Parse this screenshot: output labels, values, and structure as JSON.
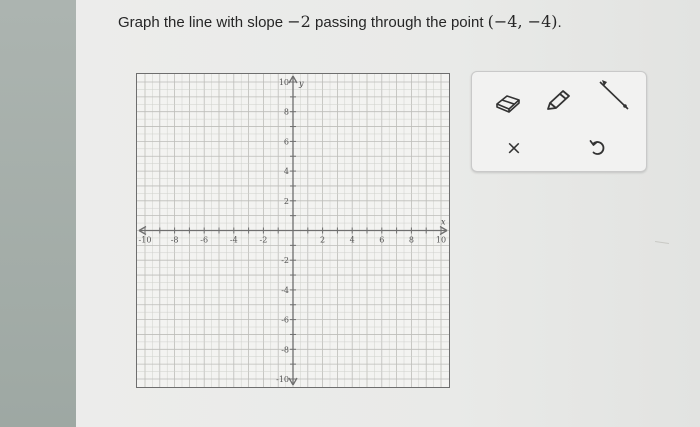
{
  "question": {
    "prefix": "Graph the line with slope ",
    "slope": "−2",
    "middle": " passing through the point ",
    "point": "(−4, −4)",
    "suffix": "."
  },
  "graph": {
    "x_range": [
      -10,
      10
    ],
    "y_range": [
      -10,
      10
    ],
    "grid_step": 0.5,
    "labeled_step": 2,
    "x_axis_label": "x",
    "y_axis_label": "y",
    "x_tick_labels": [
      "-10",
      "-8",
      "-6",
      "-4",
      "-2",
      "2",
      "4",
      "6",
      "8",
      "10"
    ],
    "y_tick_labels": [
      "10",
      "8",
      "6",
      "4",
      "2",
      "-2",
      "-4",
      "-6",
      "-8",
      "-10"
    ]
  },
  "toolbar": {
    "eraser": "eraser-icon",
    "pencil": "pencil-icon",
    "line": "line-tool-icon",
    "clear": "×",
    "undo": "undo-icon"
  },
  "colors": {
    "grid": "#cfd0cc",
    "grid_major": "#bdbdb9",
    "axis": "#6f6f6f",
    "text": "#262626"
  }
}
